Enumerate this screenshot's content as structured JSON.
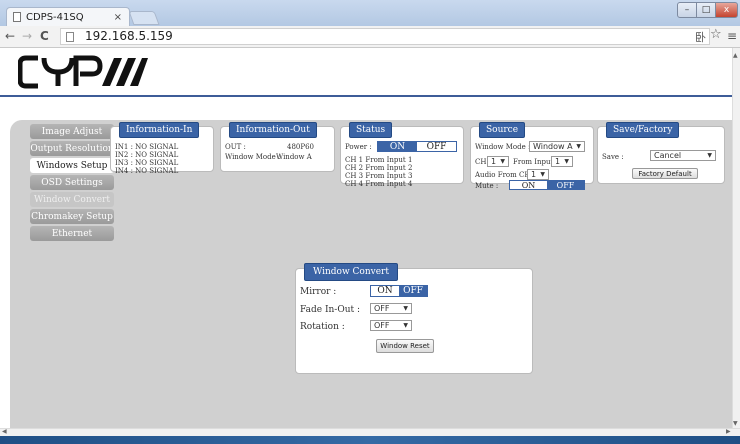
{
  "browser": {
    "tab_title": "CDPS-41SQ",
    "tab_close": "×",
    "url": "192.168.5.159",
    "nav_back": "←",
    "nav_forward": "→",
    "nav_reload": "C",
    "star_icon": "☆",
    "menu_icon": "≡",
    "window_min": "–",
    "window_max": "□",
    "window_close": "x"
  },
  "logo": "CYP",
  "menu": {
    "items": [
      {
        "label": "Image Adjust",
        "state": "normal"
      },
      {
        "label": "Output Resolution",
        "state": "normal"
      },
      {
        "label": "Windows Setup",
        "state": "active"
      },
      {
        "label": "OSD Settings",
        "state": "normal"
      },
      {
        "label": "Window Convert",
        "state": "dim"
      },
      {
        "label": "Chromakey Setup",
        "state": "normal"
      },
      {
        "label": "Ethernet",
        "state": "normal"
      }
    ]
  },
  "info_in": {
    "title": "Information-In",
    "lines": [
      "IN1 : NO SIGNAL",
      "IN2 : NO SIGNAL",
      "IN3 : NO SIGNAL",
      "IN4 : NO SIGNAL"
    ]
  },
  "info_out": {
    "title": "Information-Out",
    "out_label": "OUT :",
    "out_value": "480P60",
    "window_mode_label": "Window Mode :",
    "window_mode_value": "Window A"
  },
  "status": {
    "title": "Status",
    "power_label": "Power :",
    "power_on": "ON",
    "power_off": "OFF",
    "lines": [
      "CH 1 From Input  1",
      "CH 2 From Input  2",
      "CH 3 From Input  3",
      "CH 4 From Input  4"
    ]
  },
  "source": {
    "title": "Source",
    "window_mode_label": "Window Mode :",
    "window_mode_value": "Window A",
    "ch_label": "CH",
    "ch_value": "1",
    "from_input_label": "From Input",
    "from_input_value": "1",
    "audio_label": "Audio From CH",
    "audio_value": "1",
    "mute_label": "Mute :",
    "mute_on": "ON",
    "mute_off": "OFF"
  },
  "save_factory": {
    "title": "Save/Factory",
    "save_label": "Save :",
    "save_value": "Cancel",
    "factory_button": "Factory Default"
  },
  "window_convert": {
    "title": "Window Convert",
    "mirror_label": "Mirror :",
    "mirror_on": "ON",
    "mirror_off": "OFF",
    "fade_label": "Fade In-Out :",
    "fade_value": "OFF",
    "rotation_label": "Rotation :",
    "rotation_value": "OFF",
    "reset_button": "Window Reset"
  },
  "colors": {
    "accent": "#3b64a6",
    "panel_bg": "#d0d0d0",
    "header_line": "#3e5c98"
  }
}
